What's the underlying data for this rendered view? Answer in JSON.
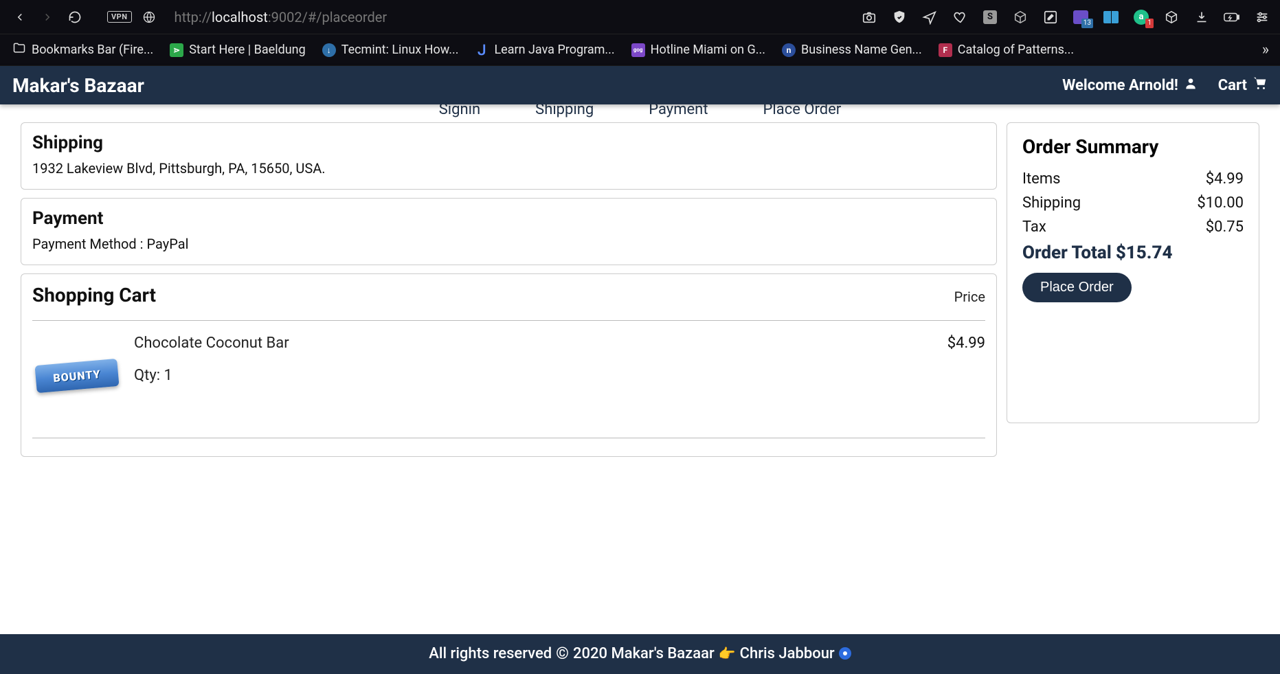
{
  "browser": {
    "url_prefix": "http://",
    "url_host": "localhost",
    "url_port": ":9002",
    "url_path": "/#/placeorder",
    "vpn_label": "VPN",
    "ext_badge_13": "13",
    "ext_badge_1": "1"
  },
  "bookmarks": [
    {
      "label": "Bookmarks Bar (Fire...",
      "color": "transparent",
      "glyph": "folder"
    },
    {
      "label": "Start Here | Baeldung",
      "color": "#2ca84a",
      "glyph": "sq"
    },
    {
      "label": "Tecmint: Linux How...",
      "color": "#2e6fa8",
      "glyph": "circle"
    },
    {
      "label": "Learn Java Program...",
      "color": "#5634bd",
      "glyph": "j"
    },
    {
      "label": "Hotline Miami on G...",
      "color": "#7c48c8",
      "glyph": "gog"
    },
    {
      "label": "Business Name Gen...",
      "color": "#2b4e9b",
      "glyph": "n"
    },
    {
      "label": "Catalog of Patterns...",
      "color": "#b12e4e",
      "glyph": "F"
    }
  ],
  "nav": {
    "brand": "Makar's Bazaar",
    "welcome": "Welcome Arnold!",
    "cart": "Cart"
  },
  "steps": {
    "signin": "Signin",
    "shipping": "Shipping",
    "payment": "Payment",
    "place": "Place Order"
  },
  "shipping": {
    "title": "Shipping",
    "address": "1932 Lakeview Blvd, Pittsburgh, PA, 15650, USA."
  },
  "payment": {
    "title": "Payment",
    "method_label": "Payment Method : ",
    "method": "PayPal"
  },
  "cart": {
    "title": "Shopping Cart",
    "price_label": "Price",
    "item": {
      "brand_text": "BOUNTY",
      "name": "Chocolate Coconut Bar",
      "qty_label": "Qty: ",
      "qty": "1",
      "price": "$4.99"
    }
  },
  "summary": {
    "title": "Order Summary",
    "items_label": "Items",
    "items_value": "$4.99",
    "shipping_label": "Shipping",
    "shipping_value": "$10.00",
    "tax_label": "Tax",
    "tax_value": "$0.75",
    "total_label": "Order Total ",
    "total_value": "$15.74",
    "button": "Place Order"
  },
  "footer": {
    "text_a": "All rights reserved ",
    "year": " 2020 Makar's Bazaar ",
    "author": "Chris Jabbour "
  }
}
